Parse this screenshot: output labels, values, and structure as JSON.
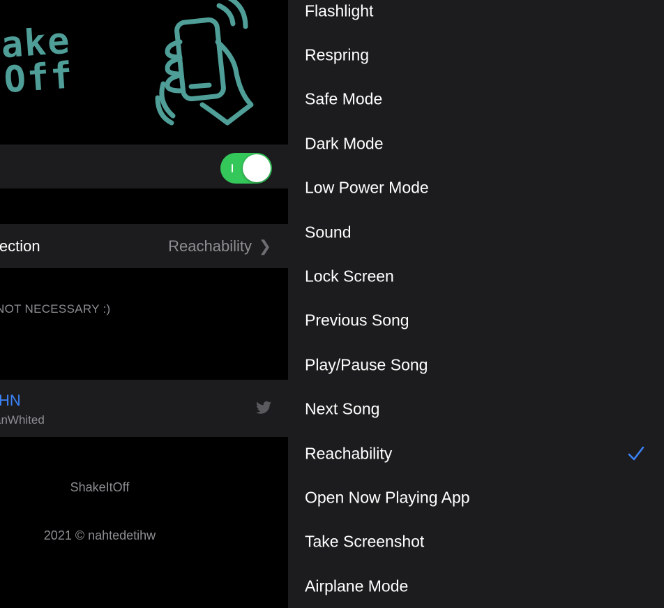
{
  "settings": {
    "logo_line1": "hake",
    "logo_line2": "Off",
    "selection_label": "lection",
    "selection_value": "Reachability",
    "footer_note": "NOT NECESSARY :)",
    "twitter_name": "HN",
    "twitter_handle": "anWhited",
    "app_name": "ShakeItOff",
    "copyright": "2021 © nahtedetihw",
    "enabled": true
  },
  "options": {
    "selected": "Reachability",
    "items": [
      "Flashlight",
      "Respring",
      "Safe Mode",
      "Dark Mode",
      "Low Power Mode",
      "Sound",
      "Lock Screen",
      "Previous Song",
      "Play/Pause Song",
      "Next Song",
      "Reachability",
      "Open Now Playing App",
      "Take Screenshot",
      "Airplane Mode"
    ]
  },
  "colors": {
    "accent": "#3a82f7",
    "toggle_on": "#34c759",
    "logo": "#4f9e98",
    "cell_bg": "#1c1c1e"
  }
}
